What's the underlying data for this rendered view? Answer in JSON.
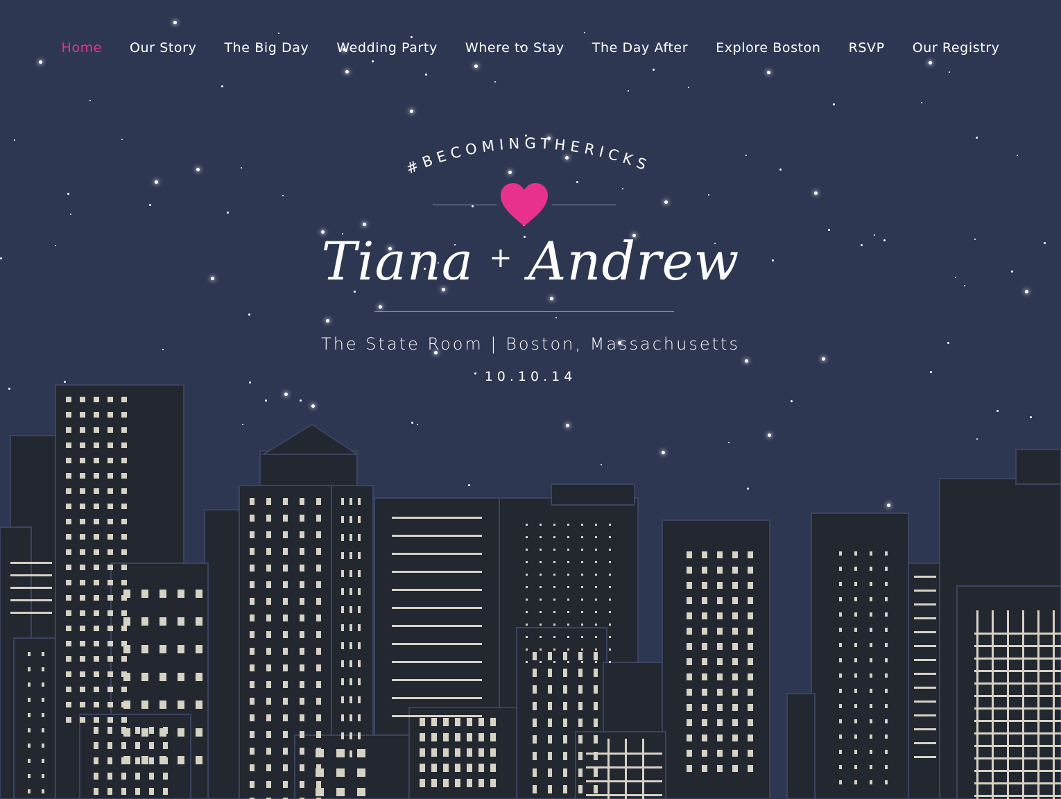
{
  "nav": {
    "items": [
      {
        "label": "Home",
        "active": true
      },
      {
        "label": "Our Story",
        "active": false
      },
      {
        "label": "The Big Day",
        "active": false
      },
      {
        "label": "Wedding Party",
        "active": false
      },
      {
        "label": "Where to Stay",
        "active": false
      },
      {
        "label": "The Day After",
        "active": false
      },
      {
        "label": "Explore Boston",
        "active": false
      },
      {
        "label": "RSVP",
        "active": false
      },
      {
        "label": "Our Registry",
        "active": false
      }
    ]
  },
  "hero": {
    "hashtag": "#BECOMINGTHERICKS",
    "name_one": "Tiana",
    "plus": "+",
    "name_two": "Andrew",
    "venue": "The State Room | Boston, Massachusetts",
    "date": "10.10.14",
    "heart_icon": "heart-icon"
  },
  "colors": {
    "sky": "#2e3752",
    "accent": "#e8318d",
    "building": "#23272f",
    "window": "#d6d2c4",
    "text": "#ffffff"
  }
}
